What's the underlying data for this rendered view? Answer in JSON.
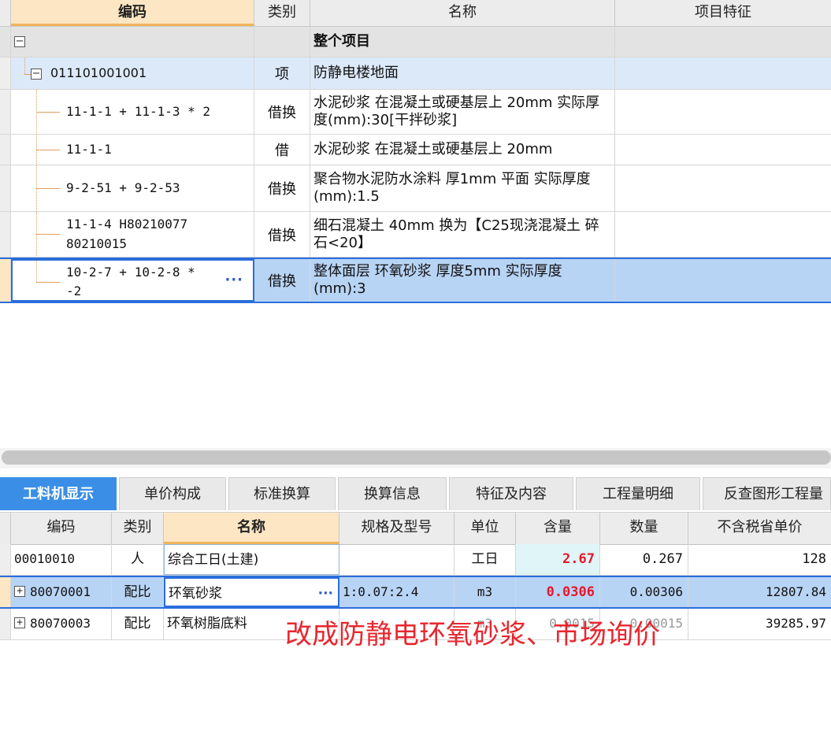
{
  "top_grid": {
    "headers": {
      "code": "编码",
      "type": "类别",
      "name": "名称",
      "feature": "项目特征"
    },
    "group_row": {
      "name": "整个项目"
    },
    "item_row": {
      "code": "011101001001",
      "type": "项",
      "name": "防静电楼地面"
    },
    "sub_rows": [
      {
        "code_line1": "11-1-1 + 11-1-3 * 2",
        "code_line2": "",
        "type": "借换",
        "name": "水泥砂浆 在混凝土或硬基层上 20mm  实际厚度(mm):30[干拌砂浆]"
      },
      {
        "code_line1": "11-1-1",
        "code_line2": "",
        "type": "借",
        "name": "水泥砂浆 在混凝土或硬基层上 20mm"
      },
      {
        "code_line1": "9-2-51 + 9-2-53",
        "code_line2": "",
        "type": "借换",
        "name": "聚合物水泥防水涂料 厚1mm 平面  实际厚度(mm):1.5"
      },
      {
        "code_line1": "11-1-4 H80210077",
        "code_line2": "80210015",
        "type": "借换",
        "name": "细石混凝土 40mm  换为【C25现浇混凝土 碎石<20】"
      },
      {
        "code_line1": "10-2-7 + 10-2-8 *",
        "code_line2": "-2",
        "type": "借换",
        "name": "整体面层 环氧砂浆 厚度5mm  实际厚度(mm):3"
      }
    ],
    "selected_ellipsis": "···"
  },
  "tabs": [
    "工料机显示",
    "单价构成",
    "标准换算",
    "换算信息",
    "特征及内容",
    "工程量明细",
    "反查图形工程量"
  ],
  "bottom_grid": {
    "headers": [
      "编码",
      "类别",
      "名称",
      "规格及型号",
      "单位",
      "含量",
      "数量",
      "不含税省单价"
    ],
    "rows": [
      {
        "code": "00010010",
        "type": "人",
        "name": "综合工日(土建)",
        "spec": "",
        "unit": "工日",
        "content": "2.67",
        "qty": "0.267",
        "price": "128",
        "expand": ""
      },
      {
        "code": "80070001",
        "type": "配比",
        "name": "环氧砂浆",
        "spec": "1:0.07:2.4",
        "unit": "m3",
        "content": "0.0306",
        "qty": "0.00306",
        "price": "12807.84",
        "expand": "+"
      },
      {
        "code": "80070003",
        "type": "配比",
        "name": "环氧树脂底料",
        "spec": "",
        "unit": "m3",
        "content": "0.0015",
        "qty": "0.00015",
        "price": "39285.97",
        "expand": "+"
      }
    ],
    "ellipsis": "···"
  },
  "annotation": "改成防静电环氧砂浆、市场询价",
  "colors": {
    "tab_active": "#3a8ee6",
    "row_selected": "#b8d4f5",
    "header_selected": "#fde6c3",
    "annotation": "#e8262e",
    "highlight_value": "#e8172b"
  }
}
